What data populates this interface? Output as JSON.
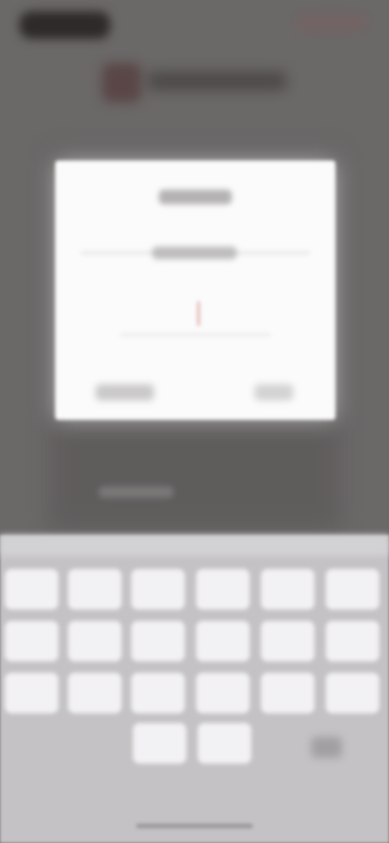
{
  "screen": {
    "theme": {
      "background": "#6b6868",
      "dialog_background": "#fbfbfb",
      "keyboard_background": "#c4c2c4",
      "key_background": "#f2f1f3",
      "cursor_color": "#d48282"
    }
  },
  "status_bar": {
    "time": "",
    "icons": [
      "signal-icon",
      "wifi-icon",
      "battery-icon"
    ]
  },
  "app_header": {
    "app_name": "",
    "logo_icon": "app-logo-icon"
  },
  "dialog": {
    "title": "",
    "label": "",
    "input": {
      "value": "",
      "placeholder": ""
    },
    "cancel_label": "",
    "ok_label": ""
  },
  "hint_text": "",
  "keyboard": {
    "rows": [
      [
        "",
        "",
        "",
        "",
        "",
        ""
      ],
      [
        "",
        "",
        "",
        "",
        "",
        ""
      ],
      [
        "",
        "",
        "",
        "",
        "",
        ""
      ],
      [
        "",
        ""
      ]
    ],
    "backspace_icon": "backspace-icon"
  }
}
